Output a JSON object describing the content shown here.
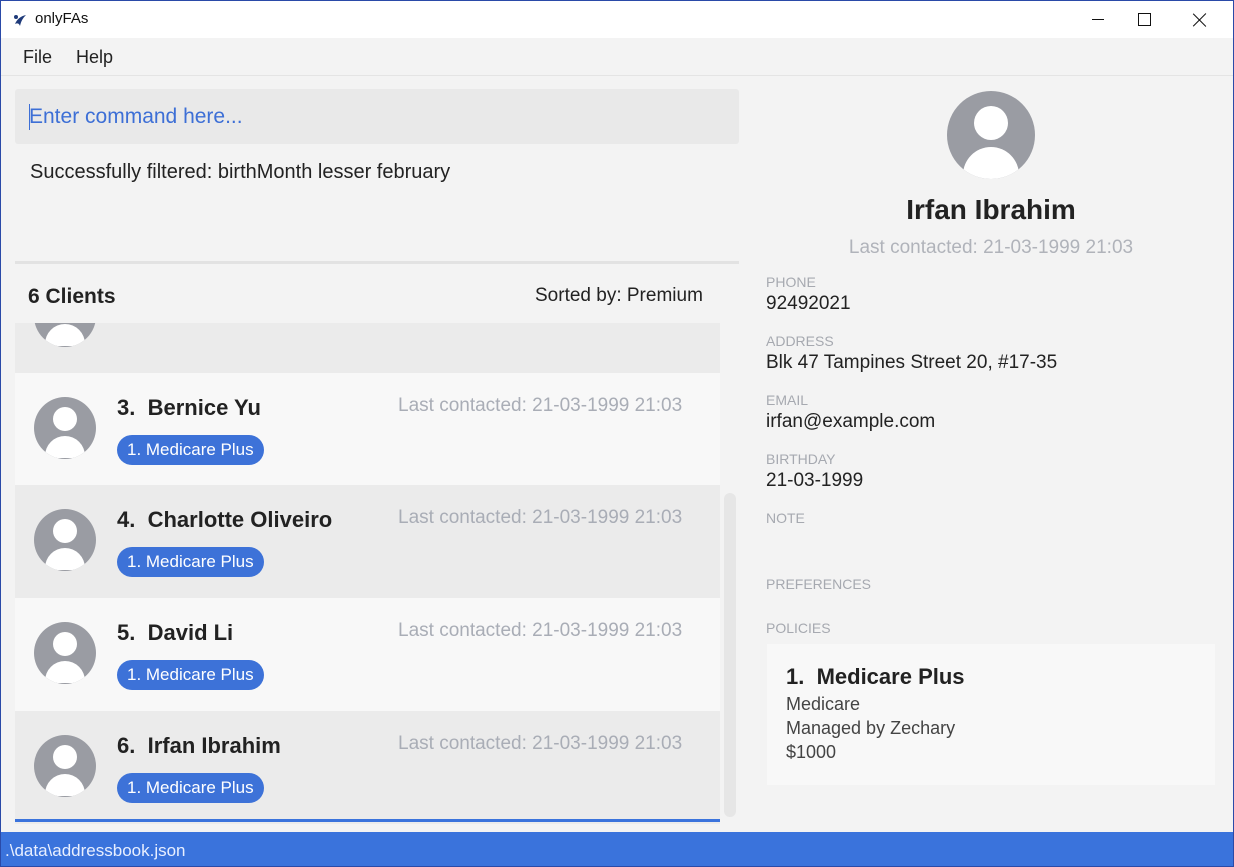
{
  "window": {
    "title": "onlyFAs"
  },
  "menu": {
    "file": "File",
    "help": "Help"
  },
  "command": {
    "placeholder": "Enter command here...",
    "value": ""
  },
  "result": {
    "message": "Successfully filtered: birthMonth lesser february"
  },
  "list": {
    "count_label": "6 Clients",
    "sorted_label": "Sorted by: Premium",
    "clients": [
      {
        "index": "3.",
        "name": "Bernice Yu",
        "last_contacted": "Last contacted: 21-03-1999 21:03",
        "tag": "1. Medicare Plus"
      },
      {
        "index": "4.",
        "name": "Charlotte Oliveiro",
        "last_contacted": "Last contacted: 21-03-1999 21:03",
        "tag": "1. Medicare Plus"
      },
      {
        "index": "5.",
        "name": "David Li",
        "last_contacted": "Last contacted: 21-03-1999 21:03",
        "tag": "1. Medicare Plus"
      },
      {
        "index": "6.",
        "name": "Irfan Ibrahim",
        "last_contacted": "Last contacted: 21-03-1999 21:03",
        "tag": "1. Medicare Plus"
      }
    ]
  },
  "detail": {
    "name": "Irfan Ibrahim",
    "last_contacted": "Last contacted: 21-03-1999 21:03",
    "phone_label": "PHONE",
    "phone": "92492021",
    "address_label": "ADDRESS",
    "address": "Blk 47 Tampines Street 20, #17-35",
    "email_label": "EMAIL",
    "email": "irfan@example.com",
    "birthday_label": "BIRTHDAY",
    "birthday": "21-03-1999",
    "note_label": "NOTE",
    "preferences_label": "PREFERENCES",
    "policies_label": "POLICIES",
    "policy": {
      "title": "1.  Medicare Plus",
      "company": "Medicare",
      "manager": "Managed by Zechary",
      "premium": "$1000"
    }
  },
  "status": {
    "path": ".\\data\\addressbook.json"
  },
  "colors": {
    "accent": "#3a73dc",
    "tag": "#3d72d8",
    "muted": "#a9adb6"
  }
}
